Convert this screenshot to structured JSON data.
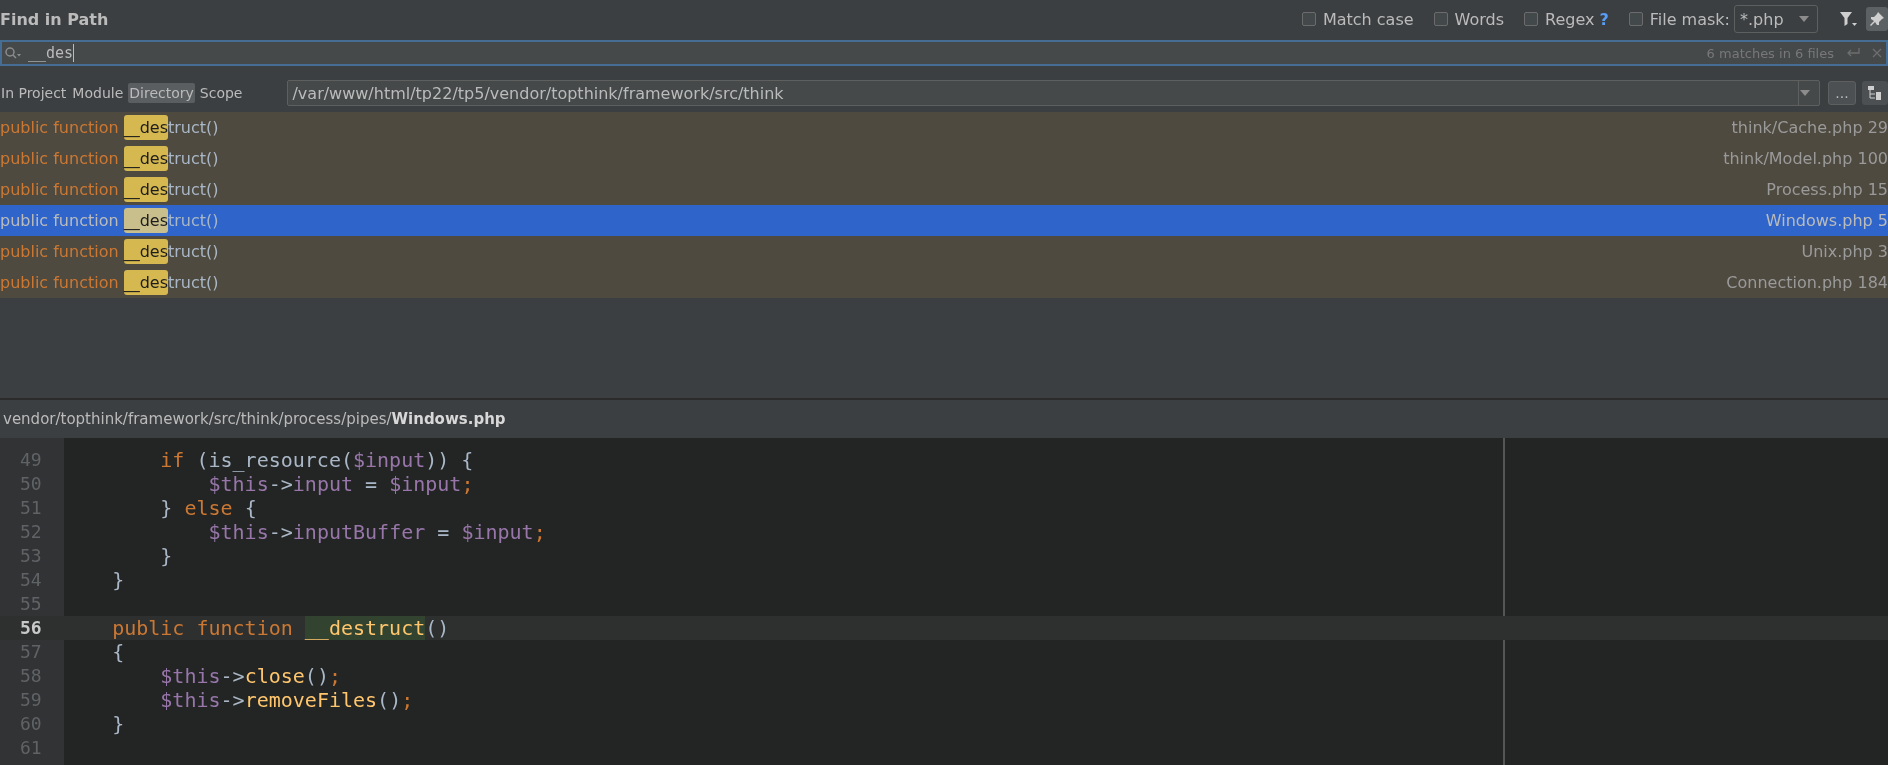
{
  "dialog": {
    "title": "Find in Path"
  },
  "options": [
    {
      "label": "Match case",
      "checked": false
    },
    {
      "label": "Words",
      "checked": false
    },
    {
      "label": "Regex",
      "checked": false,
      "help": "?"
    }
  ],
  "file_mask": {
    "label": "File mask:",
    "checked": false,
    "value": "*.php"
  },
  "search": {
    "value": "__des",
    "summary": "6 matches in 6 files"
  },
  "scope_tabs": [
    {
      "label": "In Project",
      "selected": false
    },
    {
      "label": "Module",
      "selected": false
    },
    {
      "label": "Directory",
      "selected": true
    },
    {
      "label": "Scope",
      "selected": false
    }
  ],
  "directory": {
    "value": "/var/www/html/tp22/tp5/vendor/topthink/framework/src/think",
    "browse": "..."
  },
  "results": [
    {
      "prefix": "public function ",
      "match": "__des",
      "suffix": "truct()",
      "location": "think/Cache.php 29",
      "selected": false
    },
    {
      "prefix": "public function ",
      "match": "__des",
      "suffix": "truct()",
      "location": "think/Model.php 100",
      "selected": false
    },
    {
      "prefix": "public function ",
      "match": "__des",
      "suffix": "truct()",
      "location": "Process.php 15",
      "selected": false
    },
    {
      "prefix": "public function ",
      "match": "__des",
      "suffix": "truct()",
      "location": "Windows.php 5",
      "selected": true
    },
    {
      "prefix": "public function ",
      "match": "__des",
      "suffix": "truct()",
      "location": "Unix.php 3",
      "selected": false
    },
    {
      "prefix": "public function ",
      "match": "__des",
      "suffix": "truct()",
      "location": "Connection.php 184",
      "selected": false
    }
  ],
  "preview": {
    "path": "vendor/topthink/framework/src/think/process/pipes/**Windows.php**",
    "lines": [
      {
        "number": "49",
        "current": false,
        "tokens": [
          {
            "text": "        if ",
            "kind": "keyword"
          },
          {
            "text": "(is_resource(",
            "kind": "plain"
          },
          {
            "text": "$input",
            "kind": "variable"
          },
          {
            "text": ")) {",
            "kind": "plain"
          }
        ]
      },
      {
        "number": "50",
        "current": false,
        "tokens": [
          {
            "text": "            $this",
            "kind": "variable"
          },
          {
            "text": "->",
            "kind": "plain"
          },
          {
            "text": "input",
            "kind": "variable"
          },
          {
            "text": " = ",
            "kind": "plain"
          },
          {
            "text": "$input",
            "kind": "variable"
          },
          {
            "text": ";",
            "kind": "keyword"
          }
        ]
      },
      {
        "number": "51",
        "current": false,
        "tokens": [
          {
            "text": "        } ",
            "kind": "plain"
          },
          {
            "text": "else",
            "kind": "keyword"
          },
          {
            "text": " {",
            "kind": "plain"
          }
        ]
      },
      {
        "number": "52",
        "current": false,
        "tokens": [
          {
            "text": "            $this",
            "kind": "variable"
          },
          {
            "text": "->",
            "kind": "plain"
          },
          {
            "text": "inputBuffer",
            "kind": "variable"
          },
          {
            "text": " = ",
            "kind": "plain"
          },
          {
            "text": "$input",
            "kind": "variable"
          },
          {
            "text": ";",
            "kind": "keyword"
          }
        ]
      },
      {
        "number": "53",
        "current": false,
        "tokens": [
          {
            "text": "        }",
            "kind": "plain"
          }
        ]
      },
      {
        "number": "54",
        "current": false,
        "tokens": [
          {
            "text": "    }",
            "kind": "plain"
          }
        ]
      },
      {
        "number": "55",
        "current": false
      },
      {
        "number": "56",
        "current": true,
        "tokens": [
          {
            "text": "    public function ",
            "kind": "keyword"
          },
          {
            "text": "__destruct",
            "kind": "match"
          },
          {
            "text": "()",
            "kind": "plain"
          }
        ]
      },
      {
        "number": "57",
        "current": false,
        "tokens": [
          {
            "text": "    {",
            "kind": "plain"
          }
        ]
      },
      {
        "number": "58",
        "current": false,
        "tokens": [
          {
            "text": "        $this",
            "kind": "variable"
          },
          {
            "text": "->",
            "kind": "plain"
          },
          {
            "text": "close",
            "kind": "method"
          },
          {
            "text": "()",
            "kind": "plain"
          },
          {
            "text": ";",
            "kind": "keyword"
          }
        ]
      },
      {
        "number": "59",
        "current": false,
        "tokens": [
          {
            "text": "        $this",
            "kind": "variable"
          },
          {
            "text": "->",
            "kind": "plain"
          },
          {
            "text": "removeFiles",
            "kind": "method"
          },
          {
            "text": "()",
            "kind": "plain"
          },
          {
            "text": ";",
            "kind": "keyword"
          }
        ]
      },
      {
        "number": "60",
        "current": false,
        "tokens": [
          {
            "text": "    }",
            "kind": "plain"
          }
        ]
      },
      {
        "number": "61",
        "current": false
      }
    ]
  }
}
